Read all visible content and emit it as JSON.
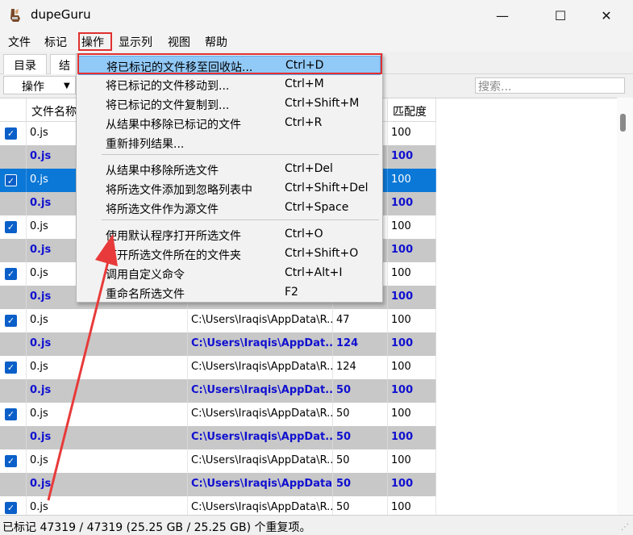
{
  "window": {
    "title": "dupeGuru"
  },
  "menubar": [
    "文件",
    "标记",
    "操作",
    "显示列",
    "视图",
    "帮助"
  ],
  "tabs": [
    "目录",
    "结"
  ],
  "toolbar": {
    "action_label": "操作",
    "search_placeholder": "搜索..."
  },
  "columns": [
    "文件名称",
    "匹配度"
  ],
  "rows": [
    {
      "name": "0.js",
      "folder": "",
      "size": "",
      "match": "100"
    },
    {
      "name": "0.js",
      "folder": "",
      "size": "",
      "match": "100"
    },
    {
      "name": "0.js",
      "folder": "",
      "size": "",
      "match": "100"
    },
    {
      "name": "0.js",
      "folder": "",
      "size": "",
      "match": "100"
    },
    {
      "name": "0.js",
      "folder": "",
      "size": "",
      "match": "100"
    },
    {
      "name": "0.js",
      "folder": "",
      "size": "",
      "match": "100"
    },
    {
      "name": "0.js",
      "folder": "",
      "size": "",
      "match": "100"
    },
    {
      "name": "0.js",
      "folder": "",
      "size": "",
      "match": "100"
    },
    {
      "name": "0.js",
      "folder": "C:\\Users\\Iraqis\\AppData\\R...",
      "size": "47",
      "match": "100"
    },
    {
      "name": "0.js",
      "folder": "C:\\Users\\Iraqis\\AppDat...",
      "size": "124",
      "match": "100"
    },
    {
      "name": "0.js",
      "folder": "C:\\Users\\Iraqis\\AppData\\R...",
      "size": "124",
      "match": "100"
    },
    {
      "name": "0.js",
      "folder": "C:\\Users\\Iraqis\\AppDat...",
      "size": "50",
      "match": "100"
    },
    {
      "name": "0.js",
      "folder": "C:\\Users\\Iraqis\\AppData\\R...",
      "size": "50",
      "match": "100"
    },
    {
      "name": "0.js",
      "folder": "C:\\Users\\Iraqis\\AppDat...",
      "size": "50",
      "match": "100"
    },
    {
      "name": "0.js",
      "folder": "C:\\Users\\Iraqis\\AppData\\R...",
      "size": "50",
      "match": "100"
    },
    {
      "name": "0.js",
      "folder": "C:\\Users\\Iraqis\\AppData\\R...",
      "size": "50",
      "match": "100"
    },
    {
      "name": "0.js",
      "folder": "C:\\Users\\Iraqis\\AppData\\R...",
      "size": "50",
      "match": "100"
    }
  ],
  "dropdown": {
    "groups": [
      [
        {
          "label": "将已标记的文件移至回收站...",
          "shortcut": "Ctrl+D"
        },
        {
          "label": "将已标记的文件移动到...",
          "shortcut": "Ctrl+M"
        },
        {
          "label": "将已标记的文件复制到...",
          "shortcut": "Ctrl+Shift+M"
        },
        {
          "label": "从结果中移除已标记的文件",
          "shortcut": "Ctrl+R"
        },
        {
          "label": "重新排列结果...",
          "shortcut": ""
        }
      ],
      [
        {
          "label": "从结果中移除所选文件",
          "shortcut": "Ctrl+Del"
        },
        {
          "label": "将所选文件添加到忽略列表中",
          "shortcut": "Ctrl+Shift+Del"
        },
        {
          "label": "将所选文件作为源文件",
          "shortcut": "Ctrl+Space"
        }
      ],
      [
        {
          "label": "使用默认程序打开所选文件",
          "shortcut": "Ctrl+O"
        },
        {
          "label": "打开所选文件所在的文件夹",
          "shortcut": "Ctrl+Shift+O"
        },
        {
          "label": "调用自定义命令",
          "shortcut": "Ctrl+Alt+I"
        },
        {
          "label": "重命名所选文件",
          "shortcut": "F2"
        }
      ]
    ]
  },
  "status": "已标记 47319 / 47319 (25.25 GB / 25.25 GB) 个重复项。",
  "colors": {
    "annotation": "#e03030",
    "highlight": "#91c9f7",
    "selected_row": "#0b78d7",
    "ref_text": "#1010d0"
  }
}
